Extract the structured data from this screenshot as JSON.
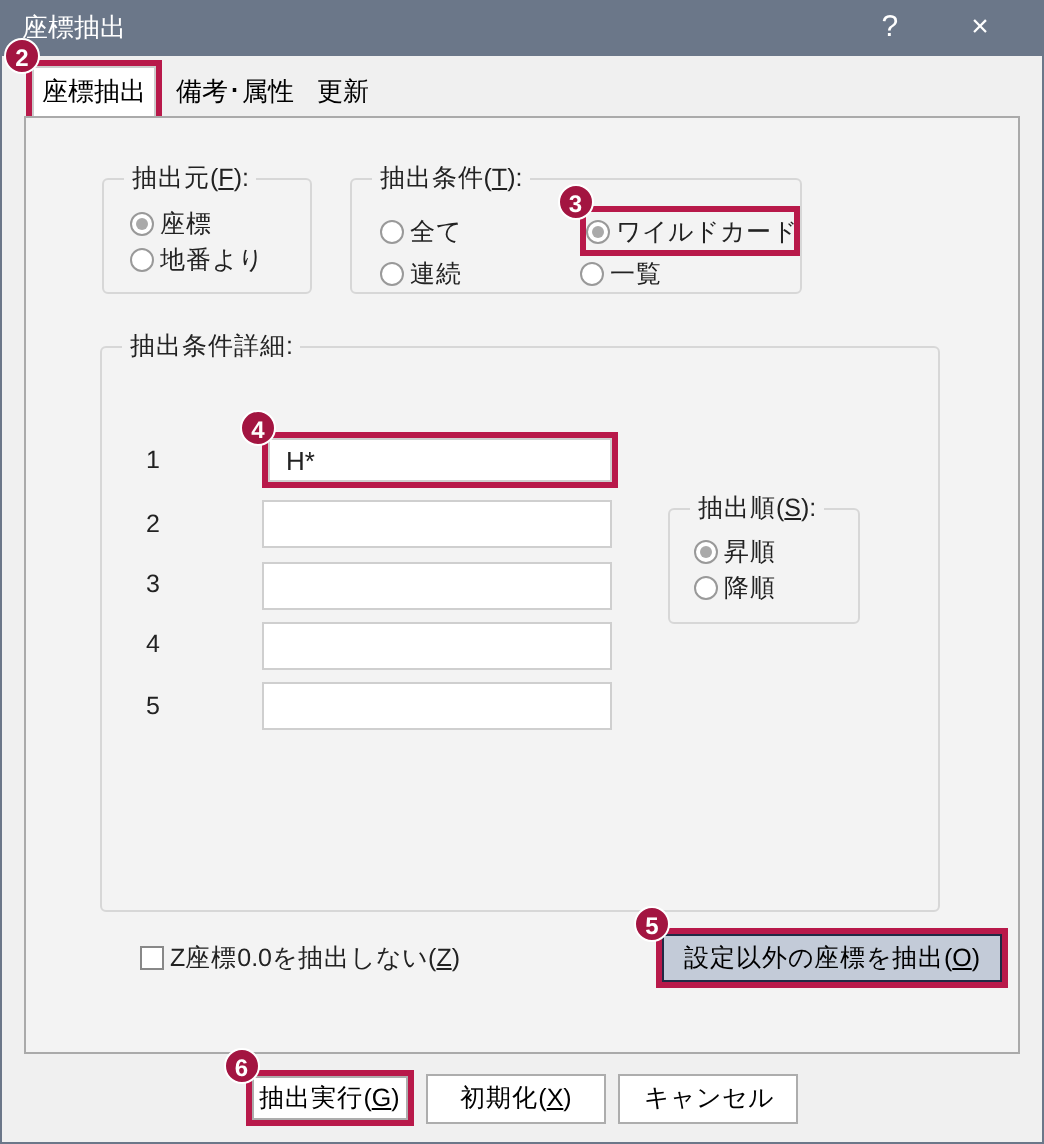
{
  "window": {
    "title": "座標抽出",
    "buttons": [
      "?",
      "×"
    ]
  },
  "tabs": [
    {
      "label": "座標抽出",
      "selected": true,
      "callout": "2"
    },
    {
      "label": "備考･属性",
      "selected": false
    },
    {
      "label": "更新",
      "selected": false
    }
  ],
  "source_group": {
    "label_parts": [
      "抽出元(",
      "F",
      "):"
    ],
    "options": [
      {
        "label": "座標",
        "selected": true
      },
      {
        "label": "地番より",
        "selected": false
      }
    ]
  },
  "condition_group": {
    "label_parts": [
      "抽出条件(",
      "T",
      "):"
    ],
    "options": [
      {
        "label": "全て",
        "selected": false
      },
      {
        "label": "ワイルドカード",
        "selected": true,
        "callout": "3"
      },
      {
        "label": "連続",
        "selected": false
      },
      {
        "label": "一覧",
        "selected": false
      }
    ]
  },
  "detail_group": {
    "label": "抽出条件詳細:",
    "rows": [
      {
        "number": "1",
        "value": "H*",
        "callout": "4"
      },
      {
        "number": "2"
      },
      {
        "number": "3"
      },
      {
        "number": "4"
      },
      {
        "number": "5"
      }
    ]
  },
  "order_group": {
    "label_parts": [
      "抽出順(",
      "S",
      "):"
    ],
    "options": [
      {
        "label": "昇順",
        "selected": true
      },
      {
        "label": "降順",
        "selected": false
      }
    ]
  },
  "exclude_checkbox": {
    "label_parts": [
      "Z座標0.0を抽出しない(",
      "Z",
      ")"
    ],
    "checked": false
  },
  "exclude_button": {
    "label_parts": [
      "設定以外の座標を抽出(",
      "O",
      ")"
    ],
    "pressed": true,
    "callout": "5"
  },
  "footer_buttons": [
    {
      "label_parts": [
        "抽出実行(",
        "G",
        ")"
      ],
      "callout": "6"
    },
    {
      "label_parts": [
        "初期化(",
        "X",
        ")"
      ]
    },
    {
      "label_parts": [
        "キャンセル"
      ]
    }
  ]
}
